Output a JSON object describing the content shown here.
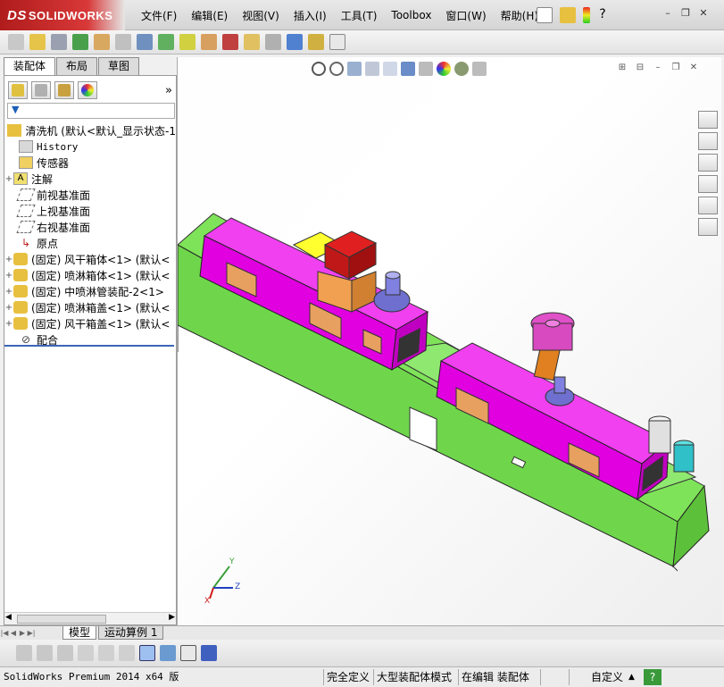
{
  "app": {
    "logo_text": "SOLIDWORKS",
    "logo_mark": "DS"
  },
  "menu": [
    "文件(F)",
    "编辑(E)",
    "视图(V)",
    "插入(I)",
    "工具(T)",
    "Toolbox",
    "窗口(W)",
    "帮助(H)"
  ],
  "window_controls": {
    "minimize": "–",
    "restore": "❐",
    "close": "✕"
  },
  "left_tabs": [
    "装配体",
    "布局",
    "草图"
  ],
  "filter": {
    "label": "▼"
  },
  "tree": [
    {
      "label": "清洗机  (默认<默认_显示状态-1",
      "kind": "assembly"
    },
    {
      "label": "History",
      "kind": "history"
    },
    {
      "label": "传感器",
      "kind": "sensor"
    },
    {
      "label": "注解",
      "kind": "annotation"
    },
    {
      "label": "前视基准面",
      "kind": "plane"
    },
    {
      "label": "上视基准面",
      "kind": "plane"
    },
    {
      "label": "右视基准面",
      "kind": "plane"
    },
    {
      "label": "原点",
      "kind": "origin"
    },
    {
      "label": "(固定) 风干箱体<1> (默认<",
      "kind": "part"
    },
    {
      "label": "(固定) 喷淋箱体<1> (默认<",
      "kind": "part"
    },
    {
      "label": "(固定) 中喷淋管装配-2<1>",
      "kind": "part"
    },
    {
      "label": "(固定) 喷淋箱盖<1> (默认<",
      "kind": "part"
    },
    {
      "label": "(固定) 风干箱盖<1> (默认<",
      "kind": "part"
    },
    {
      "label": "配合",
      "kind": "mates"
    }
  ],
  "triad": {
    "x": "X",
    "y": "Y",
    "z": "Z"
  },
  "bottom_tabs": [
    "模型",
    "运动算例 1"
  ],
  "status": {
    "version": "SolidWorks Premium 2014 x64 版",
    "state": "完全定义",
    "mode": "大型装配体模式",
    "editing": "在编辑 装配体",
    "custom": "自定义",
    "help": "?"
  },
  "colors": {
    "magenta_body": "#e000e0",
    "frame_green": "#66dd44",
    "panel_tan": "#e8a060",
    "blower_blue": "#6f6fd0",
    "accent_red": "#cc2020"
  }
}
